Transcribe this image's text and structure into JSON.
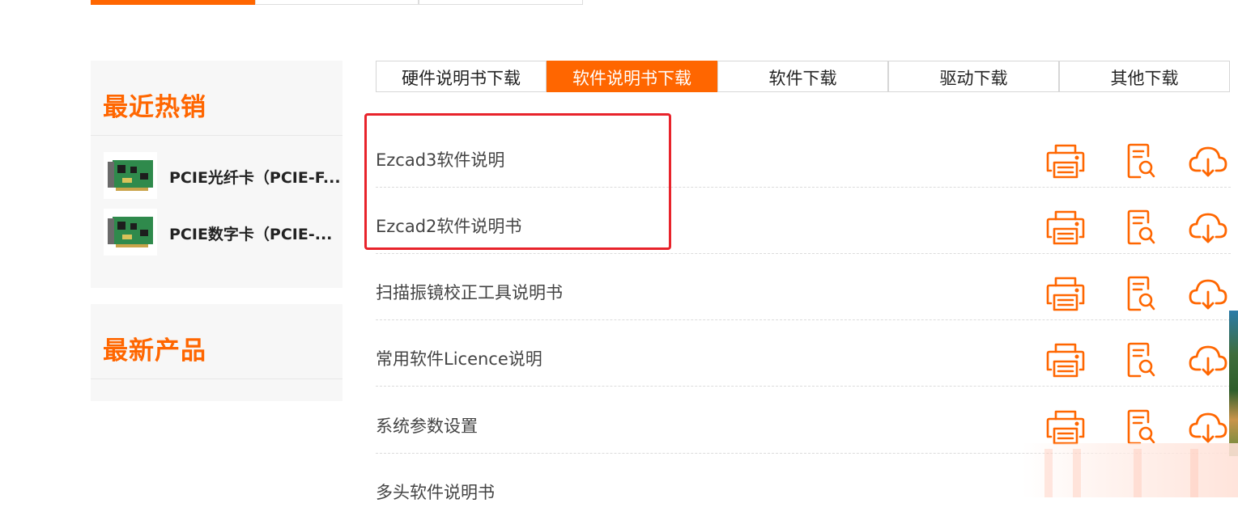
{
  "sidebar": {
    "hot_title": "最近热销",
    "new_title": "最新产品",
    "hot_items": [
      {
        "name": "PCIE光纤卡（PCIE-F..."
      },
      {
        "name": "PCIE数字卡（PCIE-..."
      }
    ]
  },
  "tabs": [
    {
      "label": "硬件说明书下载",
      "active": false
    },
    {
      "label": "软件说明书下载",
      "active": true
    },
    {
      "label": "软件下载",
      "active": false
    },
    {
      "label": "驱动下载",
      "active": false
    },
    {
      "label": "其他下载",
      "active": false
    }
  ],
  "documents": [
    {
      "title": "Ezcad3软件说明"
    },
    {
      "title": "Ezcad2软件说明书"
    },
    {
      "title": "扫描振镜校正工具说明书"
    },
    {
      "title": "常用软件Licence说明"
    },
    {
      "title": "系统参数设置"
    },
    {
      "title": "多头软件说明书"
    }
  ],
  "icons": {
    "print": "print-icon",
    "preview": "preview-icon",
    "download": "cloud-download-icon"
  },
  "colors": {
    "accent": "#ff6600",
    "highlight": "#e8232b"
  }
}
